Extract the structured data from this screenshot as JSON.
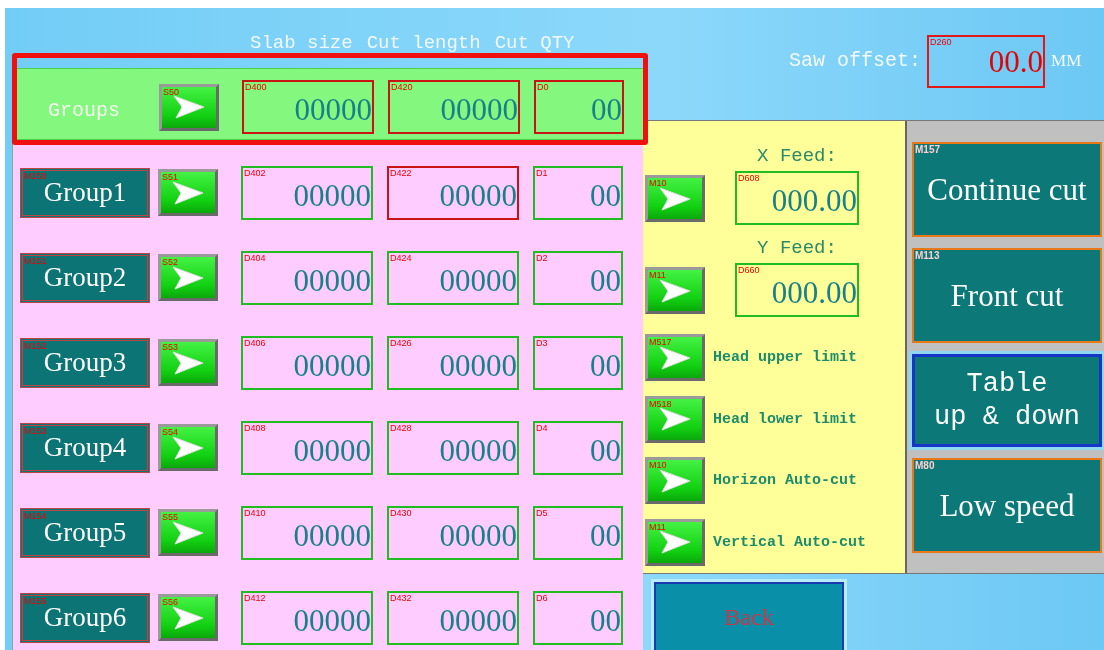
{
  "header": {
    "columns": [
      "Slab size",
      "Cut length",
      "Cut QTY"
    ]
  },
  "saw_offset": {
    "label": "Saw offset:",
    "tag": "D260",
    "value": "00.0",
    "unit": "MM"
  },
  "groups_row": {
    "label": "Groups",
    "arrow_tag": "S50",
    "fields": [
      {
        "tag": "D400",
        "value": "00000",
        "selected": true
      },
      {
        "tag": "D420",
        "value": "00000",
        "selected": true
      },
      {
        "tag": "D0",
        "value": "00",
        "selected": true
      }
    ]
  },
  "groups": [
    {
      "label": "Group1",
      "tag": "M150",
      "arrow_tag": "S51",
      "fields": [
        {
          "tag": "D402",
          "value": "00000",
          "selected": false
        },
        {
          "tag": "D422",
          "value": "00000",
          "selected": true
        },
        {
          "tag": "D1",
          "value": "00",
          "selected": false
        }
      ]
    },
    {
      "label": "Group2",
      "tag": "M151",
      "arrow_tag": "S52",
      "fields": [
        {
          "tag": "D404",
          "value": "00000",
          "selected": false
        },
        {
          "tag": "D424",
          "value": "00000",
          "selected": false
        },
        {
          "tag": "D2",
          "value": "00",
          "selected": false
        }
      ]
    },
    {
      "label": "Group3",
      "tag": "M152",
      "arrow_tag": "S53",
      "fields": [
        {
          "tag": "D406",
          "value": "00000",
          "selected": false
        },
        {
          "tag": "D426",
          "value": "00000",
          "selected": false
        },
        {
          "tag": "D3",
          "value": "00",
          "selected": false
        }
      ]
    },
    {
      "label": "Group4",
      "tag": "M153",
      "arrow_tag": "S54",
      "fields": [
        {
          "tag": "D408",
          "value": "00000",
          "selected": false
        },
        {
          "tag": "D428",
          "value": "00000",
          "selected": false
        },
        {
          "tag": "D4",
          "value": "00",
          "selected": false
        }
      ]
    },
    {
      "label": "Group5",
      "tag": "M154",
      "arrow_tag": "S55",
      "fields": [
        {
          "tag": "D410",
          "value": "00000",
          "selected": false
        },
        {
          "tag": "D430",
          "value": "00000",
          "selected": false
        },
        {
          "tag": "D5",
          "value": "00",
          "selected": false
        }
      ]
    },
    {
      "label": "Group6",
      "tag": "M155",
      "arrow_tag": "S56",
      "fields": [
        {
          "tag": "D412",
          "value": "00000",
          "selected": false
        },
        {
          "tag": "D432",
          "value": "00000",
          "selected": false
        },
        {
          "tag": "D6",
          "value": "00",
          "selected": false
        }
      ]
    }
  ],
  "feeds": [
    {
      "label": "X Feed:",
      "arrow_tag": "M10",
      "tag": "D608",
      "value": "000.00"
    },
    {
      "label": "Y Feed:",
      "arrow_tag": "M11",
      "tag": "D660",
      "value": "000.00"
    }
  ],
  "limits": [
    {
      "arrow_tag": "M517",
      "label": "Head upper limit"
    },
    {
      "arrow_tag": "M518",
      "label": "Head lower limit"
    },
    {
      "arrow_tag": "M10",
      "label": "Horizon Auto-cut"
    },
    {
      "arrow_tag": "M11",
      "label": "Vertical Auto-cut"
    }
  ],
  "side_buttons": [
    {
      "kind": "command",
      "tag": "M157",
      "label": "Continue cut"
    },
    {
      "kind": "command",
      "tag": "M113",
      "label": "Front cut"
    },
    {
      "kind": "toggle",
      "label": "Table\nup & down"
    },
    {
      "kind": "command",
      "tag": "M80",
      "label": "Low speed"
    }
  ],
  "back": {
    "label": "Back"
  }
}
